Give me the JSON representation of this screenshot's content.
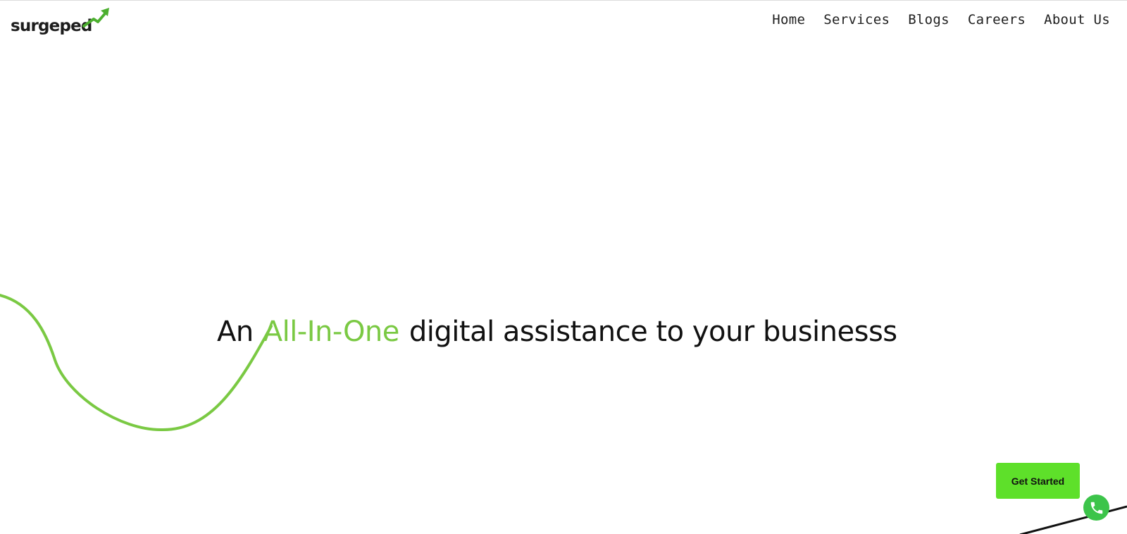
{
  "brand": {
    "logo_text": "surgeped",
    "accent_color": "#7ac943",
    "button_color": "#5ee02a"
  },
  "nav": {
    "items": [
      {
        "label": "Home"
      },
      {
        "label": "Services"
      },
      {
        "label": "Blogs"
      },
      {
        "label": "Careers"
      },
      {
        "label": "About Us"
      }
    ]
  },
  "hero": {
    "prefix": "An",
    "highlight": "All-In-One",
    "suffix": "digital assistance to your businesss"
  },
  "cta": {
    "get_started_label": "Get Started"
  },
  "icons": {
    "logo_arrow": "trending-up-arrow-icon",
    "phone": "phone-icon"
  }
}
